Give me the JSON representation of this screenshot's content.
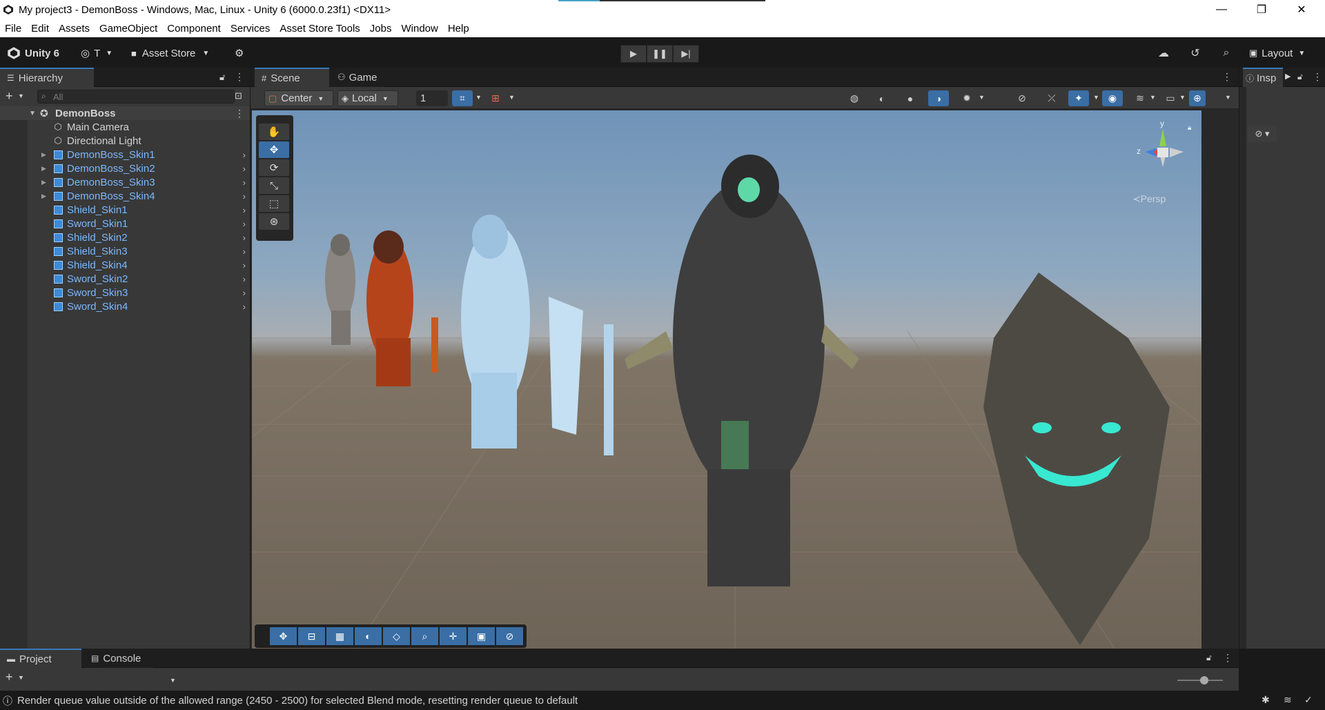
{
  "window": {
    "title": "My project3 - DemonBoss - Windows, Mac, Linux - Unity 6 (6000.0.23f1) <DX11>",
    "minimize": "—",
    "restore": "❐",
    "close": "✕"
  },
  "menu": [
    "File",
    "Edit",
    "Assets",
    "GameObject",
    "Component",
    "Services",
    "Asset Store Tools",
    "Jobs",
    "Window",
    "Help"
  ],
  "toolbar": {
    "unity_version": "Unity 6",
    "account": "T",
    "asset_store": "Asset Store",
    "layout": "Layout"
  },
  "hierarchy": {
    "tab": "Hierarchy",
    "search_placeholder": "All",
    "scene_name": "DemonBoss",
    "items": [
      {
        "label": "Main Camera",
        "prefab": false,
        "expandable": false
      },
      {
        "label": "Directional Light",
        "prefab": false,
        "expandable": false
      },
      {
        "label": "DemonBoss_Skin1",
        "prefab": true,
        "expandable": true
      },
      {
        "label": "DemonBoss_Skin2",
        "prefab": true,
        "expandable": true
      },
      {
        "label": "DemonBoss_Skin3",
        "prefab": true,
        "expandable": true
      },
      {
        "label": "DemonBoss_Skin4",
        "prefab": true,
        "expandable": true
      },
      {
        "label": "Shield_Skin1",
        "prefab": true,
        "expandable": false
      },
      {
        "label": "Sword_Skin1",
        "prefab": true,
        "expandable": false
      },
      {
        "label": "Shield_Skin2",
        "prefab": true,
        "expandable": false
      },
      {
        "label": "Shield_Skin3",
        "prefab": true,
        "expandable": false
      },
      {
        "label": "Shield_Skin4",
        "prefab": true,
        "expandable": false
      },
      {
        "label": "Sword_Skin2",
        "prefab": true,
        "expandable": false
      },
      {
        "label": "Sword_Skin3",
        "prefab": true,
        "expandable": false
      },
      {
        "label": "Sword_Skin4",
        "prefab": true,
        "expandable": false
      }
    ]
  },
  "scene": {
    "tabs": [
      "Scene",
      "Game"
    ],
    "pivot": "Center",
    "space": "Local",
    "grid_snap": "1",
    "persp_label": "Persp",
    "gizmo_y": "y",
    "gizmo_z": "z"
  },
  "inspector": {
    "tab": "Insp"
  },
  "bottom": {
    "tabs": [
      "Project",
      "Console"
    ]
  },
  "status": {
    "message": "Render queue value outside of the allowed range (2450 - 2500) for selected Blend mode, resetting render queue to default"
  }
}
